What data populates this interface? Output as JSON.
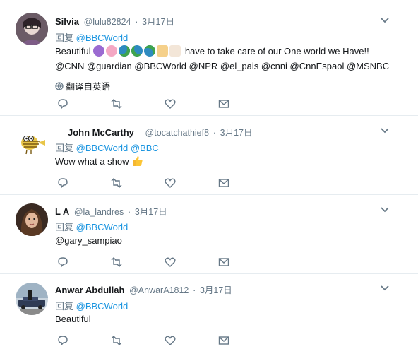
{
  "tweets": [
    {
      "name": "Silvia",
      "handle": "@lulu82824",
      "sep": "·",
      "time": "3月17日",
      "reply_prefix": "回复",
      "reply_to": "@BBCWorld",
      "text_start": "Beautiful",
      "text_end": "have to take care of our One world we Have!!",
      "mentions": "@CNN @guardian @BBCWorld @NPR @el_pais @cnni @CnnEspaol @MSNBC",
      "translate": "翻译自英语"
    },
    {
      "name": "John McCarthy",
      "handle": "@tocatchathief8",
      "sep": "·",
      "time": "3月17日",
      "reply_prefix": "回复",
      "reply_to": "@BBCWorld @BBC",
      "text": "Wow what a show"
    },
    {
      "name": "L A",
      "handle": "@la_landres",
      "sep": "·",
      "time": "3月17日",
      "reply_prefix": "回复",
      "reply_to": "@BBCWorld",
      "text": "@gary_sampiao"
    },
    {
      "name": "Anwar Abdullah",
      "handle": "@AnwarA1812",
      "sep": "·",
      "time": "3月17日",
      "reply_prefix": "回复",
      "reply_to": "@BBCWorld",
      "text": "Beautiful"
    }
  ],
  "colors": {
    "text": "#14171a",
    "muted": "#657786",
    "link": "#1b95e0",
    "divider": "#e6ecf0"
  },
  "icons": [
    "reply-icon",
    "retweet-icon",
    "like-icon",
    "message-icon",
    "chevron-down-icon",
    "globe-icon"
  ]
}
